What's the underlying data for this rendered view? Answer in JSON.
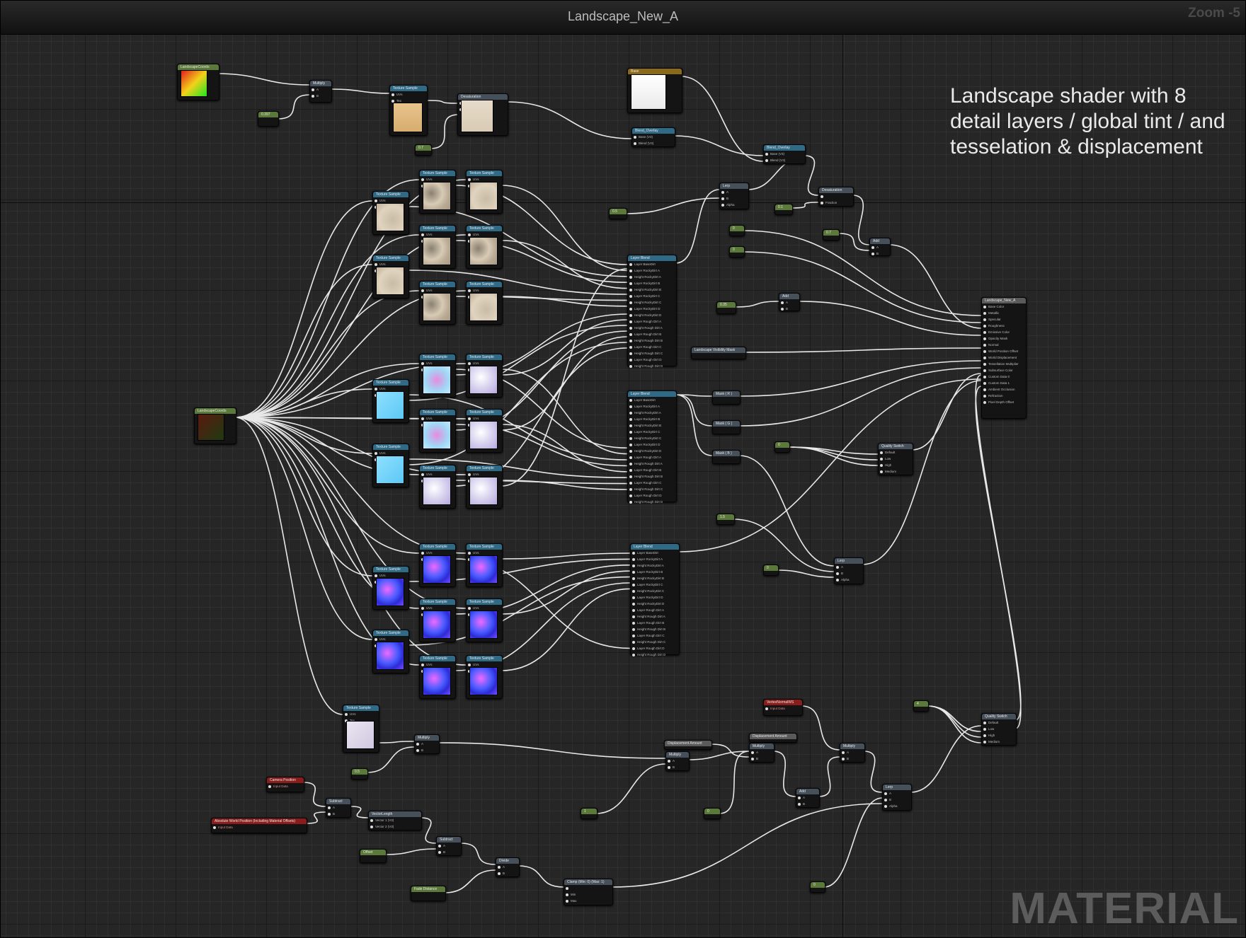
{
  "window": {
    "title": "Landscape_New_A",
    "zoom_label": "Zoom -5"
  },
  "comment": {
    "text": "Landscape shader with 8 detail layers / global tint / and tesselation & displacement"
  },
  "watermark": "MATERIAL",
  "colors": {
    "graph_bg": "#262626",
    "wire": "#e8e8e8",
    "texture_header": "#2f6a86",
    "constant_header": "#5b7a3a",
    "math_header": "#46505a",
    "param_header": "#8a1c1c",
    "output_header": "#5a5a5a"
  },
  "nodes": {
    "landscape_coords_top": {
      "header": "LandscapeCoords"
    },
    "const_top": {
      "header": "0.397"
    },
    "multiply_top": {
      "header": "Multiply",
      "pins": [
        "A",
        "B"
      ]
    },
    "tex_tint": {
      "header": "Texture Sample",
      "pins": [
        "UVs",
        "Tex"
      ]
    },
    "desaturation": {
      "header": "Desaturation",
      "pins": [
        "",
        "Fraction"
      ]
    },
    "const_desat": {
      "header": "0.7"
    },
    "base_param": {
      "header": "Base"
    },
    "blend_overlay_1": {
      "header": "Blend_Overlay",
      "pins": [
        "Base (V3)",
        "Blend (V3)"
      ]
    },
    "blend_overlay_2": {
      "header": "Blend_Overlay",
      "pins": [
        "Base (V3)",
        "Blend (V3)"
      ]
    },
    "lerp_top": {
      "header": "Lerp",
      "pins": [
        "A",
        "B",
        "Alpha"
      ]
    },
    "const_lerp_top": {
      "header": "0.5"
    },
    "desaturation_2": {
      "header": "Desaturation",
      "pins": [
        "",
        "Fraction"
      ]
    },
    "const_desat_2": {
      "header": "0.1"
    },
    "const_a": {
      "header": "0"
    },
    "const_b": {
      "header": "0"
    },
    "const_c": {
      "header": "0.7"
    },
    "add_top": {
      "header": "Add",
      "pins": [
        "A",
        "B"
      ]
    },
    "const_spec": {
      "header": "0.35"
    },
    "add_mid": {
      "header": "Add",
      "pins": [
        "A",
        "B"
      ]
    },
    "landscape_visibility": {
      "header": "Landscape Visibility Mask"
    },
    "landscape_coords_mid": {
      "header": "LandscapeCoords"
    },
    "texture_sample_label": "Texture Sample",
    "layer_blend_1": {
      "header": "Layer Blend",
      "pins": [
        "Layer BaseDirt",
        "Layer RockyDirt A",
        "Height RockyDirt A",
        "Layer RockyDirt B",
        "Height RockyDirt B",
        "Layer RockyDirt C",
        "Height RockyDirt C",
        "Layer RockyDirt D",
        "Height RockyDirt D",
        "Layer Rough Dirt A",
        "Height Rough Dirt A",
        "Layer Rough Dirt B",
        "Height Rough Dirt B",
        "Layer Rough Dirt C",
        "Height Rough Dirt C",
        "Layer Rough Dirt D",
        "Height Rough Dirt D"
      ]
    },
    "layer_blend_2": {
      "header": "Layer Blend",
      "pins": [
        "Layer BaseDirt",
        "Layer RockyDirt A",
        "Height RockyDirt A",
        "Layer RockyDirt B",
        "Height RockyDirt B",
        "Layer RockyDirt C",
        "Height RockyDirt C",
        "Layer RockyDirt D",
        "Height RockyDirt D",
        "Layer Rough Dirt A",
        "Height Rough Dirt A",
        "Layer Rough Dirt B",
        "Height Rough Dirt B",
        "Layer Rough Dirt C",
        "Height Rough Dirt C",
        "Layer Rough Dirt D",
        "Height Rough Dirt D"
      ]
    },
    "layer_blend_3": {
      "header": "Layer Blend",
      "pins": [
        "Layer BaseDirt",
        "Layer RockyDirt A",
        "Height RockyDirt A",
        "Layer RockyDirt B",
        "Height RockyDirt B",
        "Layer RockyDirt C",
        "Height RockyDirt C",
        "Layer RockyDirt D",
        "Height RockyDirt D",
        "Layer Rough Dirt A",
        "Height Rough Dirt A",
        "Layer Rough Dirt B",
        "Height Rough Dirt B",
        "Layer Rough Dirt C",
        "Height Rough Dirt C",
        "Layer Rough Dirt D",
        "Height Rough Dirt D"
      ]
    },
    "mask_r": {
      "header": "Mask ( R )"
    },
    "mask_g": {
      "header": "Mask ( G )"
    },
    "mask_b": {
      "header": "Mask ( B )"
    },
    "const_qs": {
      "header": "0"
    },
    "quality_switch_1": {
      "header": "Quality Switch",
      "pins": [
        "Default",
        "Low",
        "High",
        "Medium"
      ]
    },
    "const_mid_1": {
      "header": "1.5"
    },
    "const_mid_2": {
      "header": "0"
    },
    "lerp_mid": {
      "header": "Lerp",
      "pins": [
        "A",
        "B",
        "Alpha"
      ]
    },
    "output": {
      "header": "Landscape_New_A",
      "pins": [
        "Base Color",
        "Metallic",
        "Specular",
        "Roughness",
        "Emissive Color",
        "Opacity Mask",
        "Normal",
        "World Position Offset",
        "World Displacement",
        "Tessellation Multiplier",
        "Subsurface Color",
        "Custom Data 0",
        "Custom Data 1",
        "Ambient Occlusion",
        "Refraction",
        "Pixel Depth Offset"
      ]
    },
    "tex_disp": {
      "header": "Texture Sample",
      "pins": [
        "UVs",
        "Tex"
      ]
    },
    "multiply_disp": {
      "header": "Multiply",
      "pins": [
        "A",
        "B"
      ]
    },
    "const_disp": {
      "header": "0.5"
    },
    "camera_position": {
      "header": "Camera Position",
      "sub": "Input Data"
    },
    "abs_world_pos": {
      "header": "Absolute World Position (Including Material Offsets)",
      "sub": "Input Data"
    },
    "subtract_1": {
      "header": "Subtract",
      "pins": [
        "A",
        "B"
      ]
    },
    "vector_length": {
      "header": "VectorLength",
      "pins": [
        "Vector 1 (V3)",
        "Vector 2 (V3)"
      ],
      "outs": [
        "V3 Length",
        "V3 Length"
      ]
    },
    "subtract_2": {
      "header": "Subtract",
      "pins": [
        "A",
        "B"
      ]
    },
    "offset_param": {
      "header": "Offset"
    },
    "divide": {
      "header": "Divide",
      "pins": [
        "A",
        "B"
      ]
    },
    "fade_distance": {
      "header": "Fade Distance"
    },
    "clamp": {
      "header": "Clamp (Min: 0) (Max: 1)",
      "pins": [
        "",
        "Min",
        "Max"
      ]
    },
    "const_clamp_1": {
      "header": "1"
    },
    "const_clamp_2": {
      "header": "0"
    },
    "displacement_amount_1": {
      "header": "Displacement Amount"
    },
    "displacement_amount_2": {
      "header": "Displacement Amount"
    },
    "multiply_d1": {
      "header": "Multiply",
      "pins": [
        "A",
        "B"
      ]
    },
    "multiply_d2": {
      "header": "Multiply",
      "pins": [
        "A",
        "B"
      ]
    },
    "multiply_d3": {
      "header": "Multiply",
      "pins": [
        "A",
        "B"
      ]
    },
    "vertex_normal": {
      "header": "VertexNormalWS",
      "sub": "Input Data"
    },
    "add_disp": {
      "header": "Add",
      "pins": [
        "A",
        "B"
      ]
    },
    "lerp_bottom": {
      "header": "Lerp",
      "pins": [
        "A",
        "B",
        "Alpha"
      ]
    },
    "const_bottom": {
      "header": "0"
    },
    "const_qs2": {
      "header": "4"
    },
    "quality_switch_2": {
      "header": "Quality Switch",
      "pins": [
        "Default",
        "Low",
        "High",
        "Medium"
      ]
    }
  }
}
